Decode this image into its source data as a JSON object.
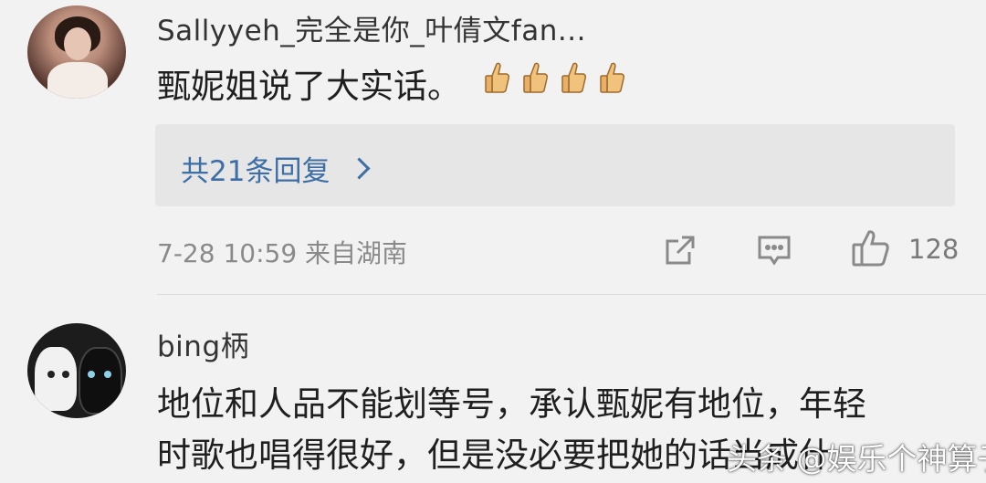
{
  "comments": [
    {
      "username": "Sallyyeh_完全是你_叶倩文fan...",
      "text": "甄妮姐说了大实话。",
      "emoji": [
        "thumbs-up",
        "thumbs-up",
        "thumbs-up",
        "thumbs-up"
      ],
      "reply_link": "共21条回复",
      "meta": "7-28 10:59  来自湖南",
      "like_count": "128"
    },
    {
      "username": "bing柄",
      "text_line1": "地位和人品不能划等号，承认甄妮有地位，年轻",
      "text_line2": "时歌也唱得很好，但是没必要把她的话当成什"
    }
  ],
  "watermark": "头条 @娱乐个神算子",
  "colors": {
    "background": "#f2f2f2",
    "reply_box": "#e6e6e6",
    "link_blue": "#3d6ea6",
    "meta_gray": "#8a8a8a"
  },
  "icons": [
    "share-icon",
    "comment-icon",
    "like-icon",
    "chevron-right-icon",
    "thumbs-up-icon"
  ]
}
